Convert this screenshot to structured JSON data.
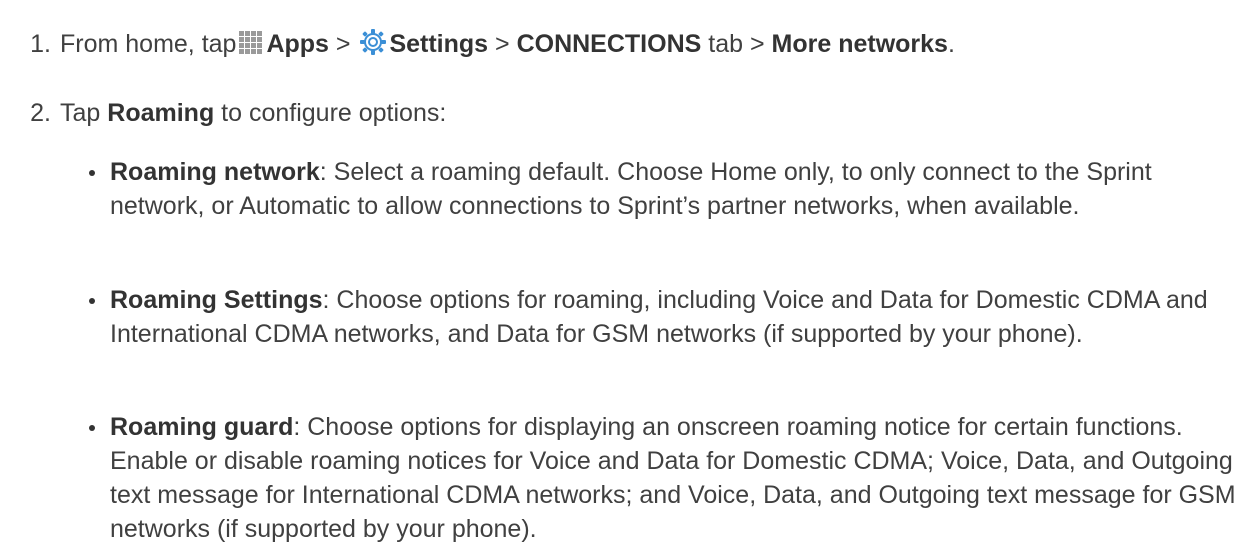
{
  "steps": [
    {
      "number": "1.",
      "text_before": "From home, tap",
      "apps_icon": "apps-grid-icon",
      "apps_label": "Apps",
      "sep1": " > ",
      "settings_icon": "settings-gear-icon",
      "settings_label": "Settings",
      "sep2": " > ",
      "tab_label": "CONNECTIONS",
      "tab_suffix": " tab > ",
      "more_label": "More networks",
      "end": "."
    },
    {
      "number": "2.",
      "text_before": "Tap ",
      "roaming_label": "Roaming",
      "text_after": " to configure options:"
    }
  ],
  "bullets": [
    {
      "term": "Roaming network",
      "description": ": Select a roaming default. Choose Home only, to only connect to the Sprint network, or Automatic to allow connections to Sprint’s partner networks, when available."
    },
    {
      "term": "Roaming Settings",
      "description": ": Choose options for roaming, including Voice and Data for Domestic CDMA and International CDMA networks, and Data for GSM networks (if supported by your phone)."
    },
    {
      "term": "Roaming guard",
      "description": ": Choose options for displaying an onscreen roaming notice for certain functions. Enable or disable roaming notices for Voice and Data for Domestic CDMA; Voice, Data, and Outgoing text message for International CDMA networks; and Voice, Data, and Outgoing text message for GSM networks (if supported by your phone)."
    }
  ],
  "colors": {
    "text": "#404040",
    "bold": "#333333",
    "apps_icon": "#9a9a9a",
    "settings_icon": "#3b8fd6"
  }
}
